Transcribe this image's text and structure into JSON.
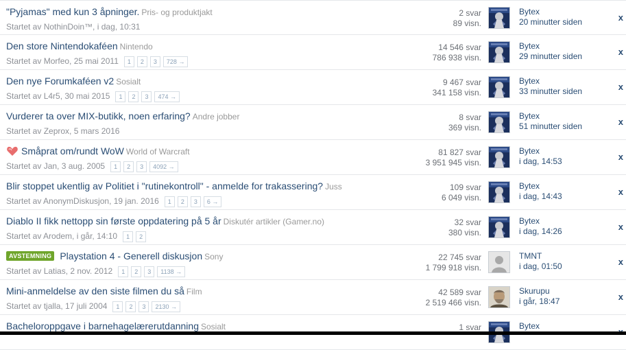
{
  "threads": [
    {
      "title": "\"Pyjamas\" med kun 3 åpninger.",
      "category": "Pris- og produktjakt",
      "starter": "Startet av NothinDoin™, i dag, 10:31",
      "pages": [],
      "replies": "2 svar",
      "views": "89 visn.",
      "last_user": "Bytex",
      "last_time": "20 minutter siden",
      "avatar": "bytex"
    },
    {
      "title": "Den store Nintendokaféen",
      "category": "Nintendo",
      "starter": "Startet av Morfeo, 25 mai 2011",
      "pages": [
        "1",
        "2",
        "3",
        "728 →"
      ],
      "replies": "14 546 svar",
      "views": "786 938 visn.",
      "last_user": "Bytex",
      "last_time": "29 minutter siden",
      "avatar": "bytex"
    },
    {
      "title": "Den nye Forumkaféen v2",
      "category": "Sosialt",
      "starter": "Startet av L4r5, 30 mai 2015",
      "pages": [
        "1",
        "2",
        "3",
        "474 →"
      ],
      "replies": "9 467 svar",
      "views": "341 158 visn.",
      "last_user": "Bytex",
      "last_time": "33 minutter siden",
      "avatar": "bytex"
    },
    {
      "title": "Vurderer ta over MIX-butikk, noen erfaring?",
      "category": "Andre jobber",
      "starter": "Startet av Zeprox, 5 mars 2016",
      "pages": [],
      "replies": "8 svar",
      "views": "369 visn.",
      "last_user": "Bytex",
      "last_time": "51 minutter siden",
      "avatar": "bytex"
    },
    {
      "title": "Småprat om/rundt WoW",
      "category": "World of Warcraft",
      "starter": "Startet av Jan, 3 aug. 2005",
      "pages": [
        "1",
        "2",
        "3",
        "4092 →"
      ],
      "replies": "81 827 svar",
      "views": "3 951 945 visn.",
      "last_user": "Bytex",
      "last_time": "i dag, 14:53",
      "avatar": "bytex",
      "hot": true
    },
    {
      "title": "Blir stoppet ukentlig av Politiet i \"rutinekontroll\" - anmelde for trakassering?",
      "category": "Juss",
      "starter": "Startet av AnonymDiskusjon, 19 jan. 2016",
      "pages": [
        "1",
        "2",
        "3",
        "6 →"
      ],
      "replies": "109 svar",
      "views": "6 049 visn.",
      "last_user": "Bytex",
      "last_time": "i dag, 14:43",
      "avatar": "bytex"
    },
    {
      "title": "Diablo II fikk nettopp sin første oppdatering på 5 år",
      "category": "Diskutér artikler (Gamer.no)",
      "starter": "Startet av Arodem, i går, 14:10",
      "pages": [
        "1",
        "2"
      ],
      "replies": "32 svar",
      "views": "380 visn.",
      "last_user": "Bytex",
      "last_time": "i dag, 14:26",
      "avatar": "bytex"
    },
    {
      "title": "Playstation 4 - Generell diskusjon",
      "category": "Sony",
      "starter": "Startet av Latias, 2 nov. 2012",
      "pages": [
        "1",
        "2",
        "3",
        "1138 →"
      ],
      "replies": "22 745 svar",
      "views": "1 799 918 visn.",
      "last_user": "TMNT",
      "last_time": "i dag, 01:50",
      "avatar": "default",
      "badge": "AVSTEMNING"
    },
    {
      "title": "Mini-anmeldelse av den siste filmen du så",
      "category": "Film",
      "starter": "Startet av tjalla, 17 juli 2004",
      "pages": [
        "1",
        "2",
        "3",
        "2130 →"
      ],
      "replies": "42 589 svar",
      "views": "2 519 466 visn.",
      "last_user": "Skurupu",
      "last_time": "i går, 18:47",
      "avatar": "skurupu"
    },
    {
      "title": "Bacheloroppgave i barnehagelærerutdanning",
      "category": "Sosialt",
      "starter": "",
      "pages": [],
      "replies": "1 svar",
      "views": "",
      "last_user": "Bytex",
      "last_time": "",
      "avatar": "bytex"
    }
  ],
  "close_glyph": "x"
}
